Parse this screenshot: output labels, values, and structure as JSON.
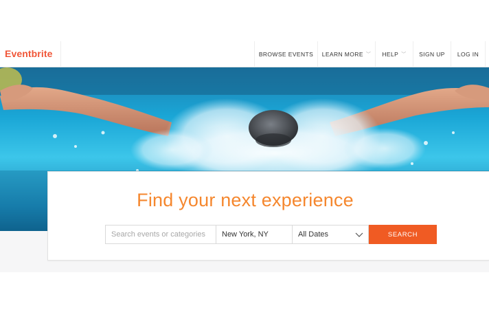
{
  "brand": {
    "name": "Eventbrite",
    "color": "#f05537"
  },
  "nav": {
    "browse": "BROWSE EVENTS",
    "learn": "LEARN MORE",
    "help": "HELP",
    "signup": "SIGN UP",
    "login": "LOG IN"
  },
  "hero": {
    "image": "swimmer-butterfly-stroke"
  },
  "search": {
    "headline": "Find your next experience",
    "query_placeholder": "Search events or categories",
    "location_value": "New York, NY",
    "date_value": "All Dates",
    "button_label": "SEARCH",
    "accent": "#f05b23"
  }
}
